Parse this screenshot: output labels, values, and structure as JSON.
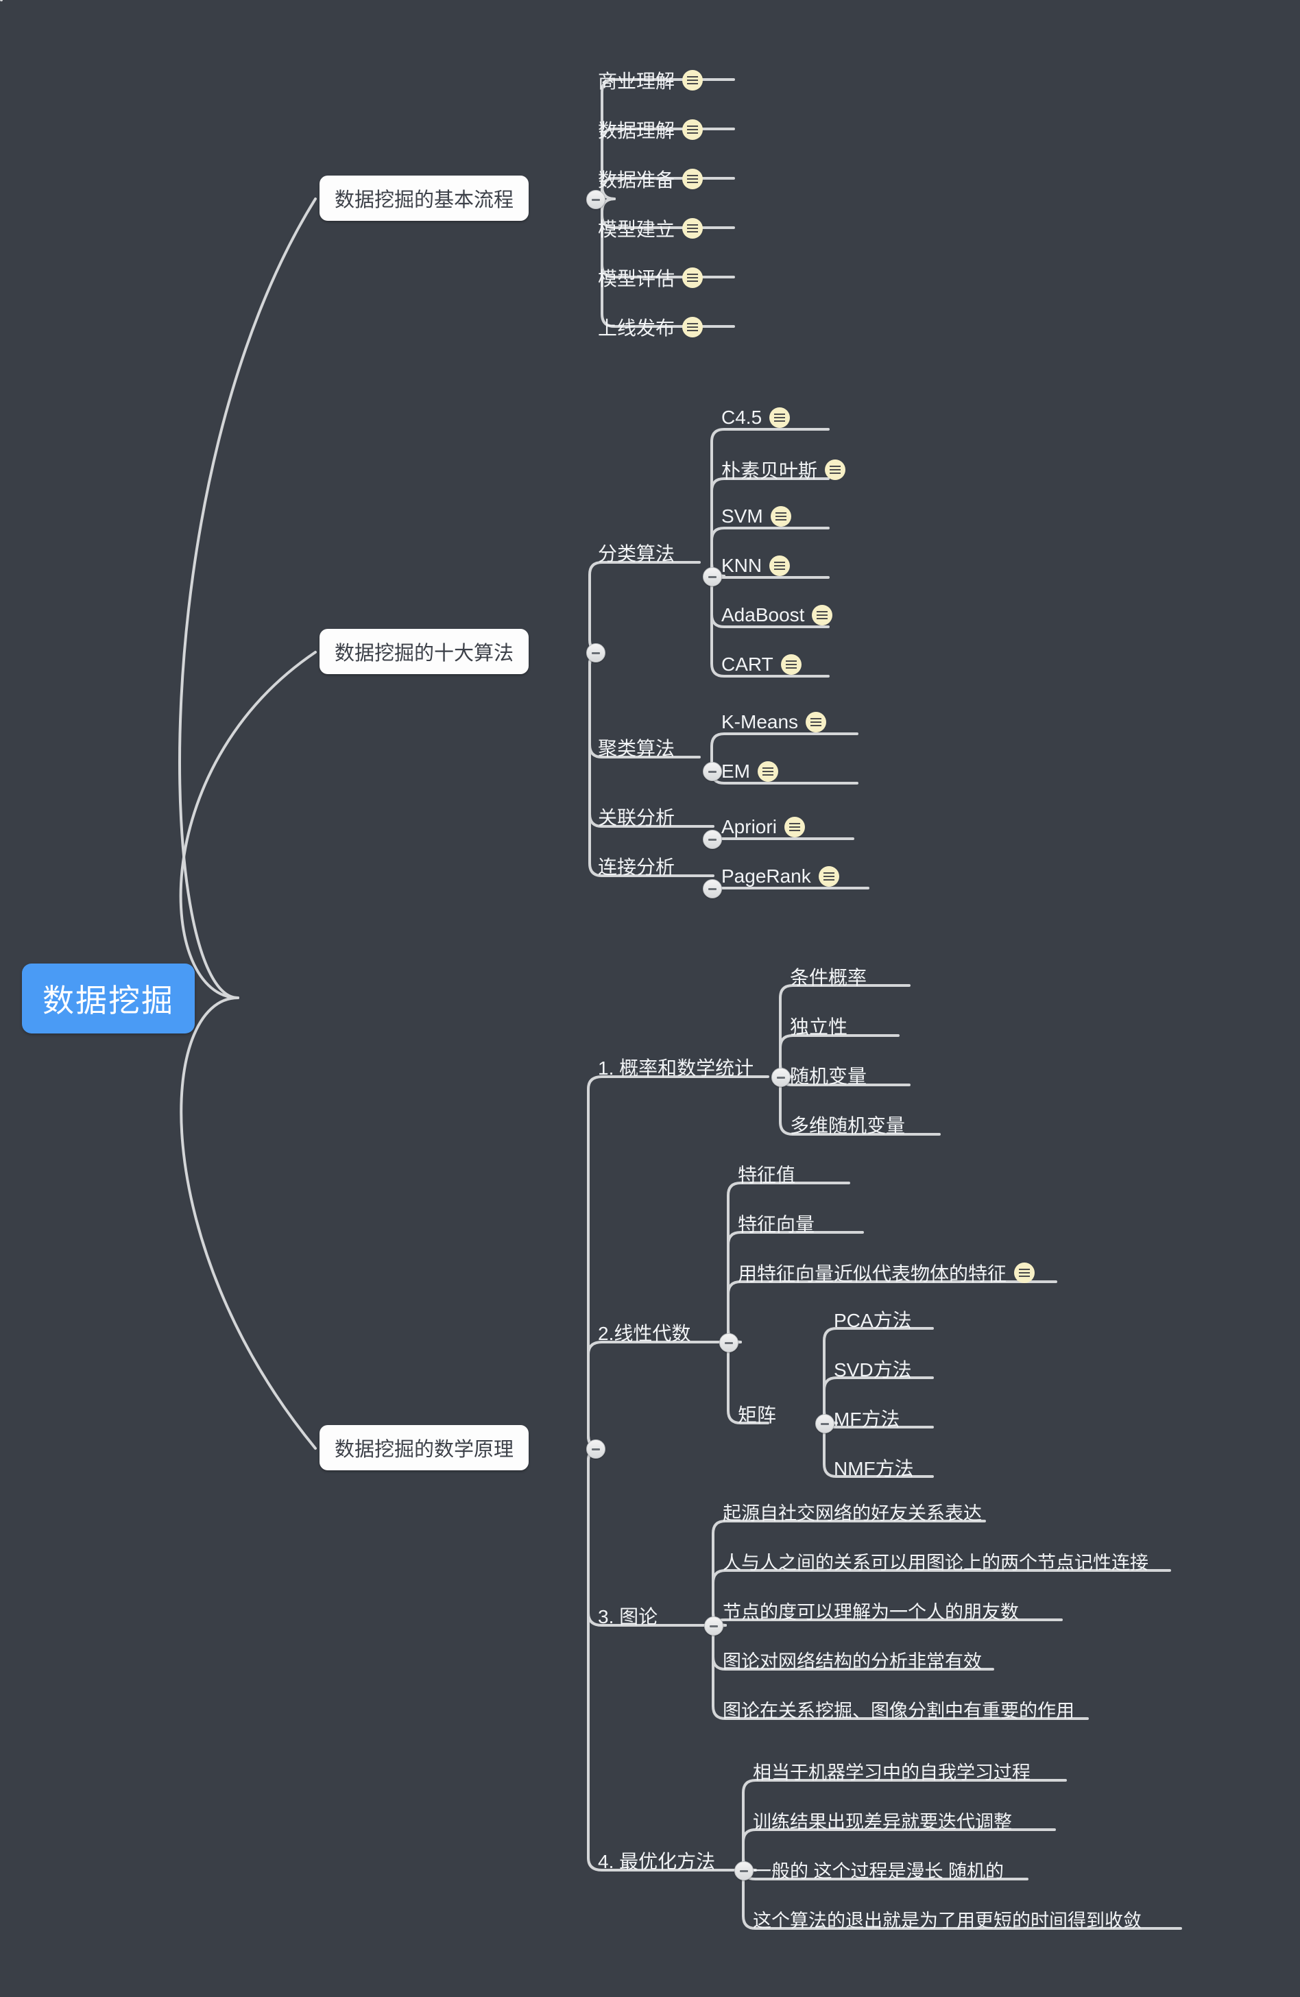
{
  "theme": {
    "background": "#3a3f47",
    "root_fill": "#4a9bf5",
    "root_text": "#ffffff",
    "branch_fill": "#fdfdfd",
    "branch_text": "#3c4048",
    "leaf_text": "#f2f4f6",
    "connector": "#d4d6d8",
    "note_icon_fill": "#f7f0c6"
  },
  "icons": {
    "note": "note-icon",
    "collapse": "collapse-minus-icon"
  },
  "root": {
    "label": "数据挖掘"
  },
  "branches": [
    {
      "id": "process",
      "label": "数据挖掘的基本流程",
      "children": [
        {
          "label": "商业理解",
          "note": true
        },
        {
          "label": "数据理解",
          "note": true
        },
        {
          "label": "数据准备",
          "note": true
        },
        {
          "label": "模型建立",
          "note": true
        },
        {
          "label": "模型评估",
          "note": true
        },
        {
          "label": "上线发布",
          "note": true
        }
      ]
    },
    {
      "id": "algorithms",
      "label": "数据挖掘的十大算法",
      "groups": [
        {
          "label": "分类算法",
          "children": [
            {
              "label": "C4.5",
              "note": true
            },
            {
              "label": "朴素贝叶斯",
              "note": true
            },
            {
              "label": "SVM",
              "note": true
            },
            {
              "label": "KNN",
              "note": true
            },
            {
              "label": "AdaBoost",
              "note": true
            },
            {
              "label": "CART",
              "note": true
            }
          ]
        },
        {
          "label": "聚类算法",
          "children": [
            {
              "label": "K-Means",
              "note": true
            },
            {
              "label": "EM",
              "note": true
            }
          ]
        },
        {
          "label": "关联分析",
          "children": [
            {
              "label": "Apriori",
              "note": true
            }
          ]
        },
        {
          "label": "连接分析",
          "children": [
            {
              "label": "PageRank",
              "note": true
            }
          ]
        }
      ]
    },
    {
      "id": "math",
      "label": "数据挖掘的数学原理",
      "groups": [
        {
          "label": "1. 概率和数学统计",
          "children": [
            {
              "label": "条件概率",
              "note": false
            },
            {
              "label": "独立性",
              "note": false
            },
            {
              "label": "随机变量",
              "note": false
            },
            {
              "label": "多维随机变量",
              "note": false
            }
          ]
        },
        {
          "label": "2.线性代数",
          "children": [
            {
              "label": "特征值",
              "note": false
            },
            {
              "label": "特征向量",
              "note": false
            },
            {
              "label": "用特征向量近似代表物体的特征",
              "note": true
            },
            {
              "label": "矩阵",
              "note": false,
              "children": [
                {
                  "label": "PCA方法",
                  "note": false
                },
                {
                  "label": "SVD方法",
                  "note": false
                },
                {
                  "label": "MF方法",
                  "note": false
                },
                {
                  "label": "NMF方法",
                  "note": false
                }
              ]
            }
          ]
        },
        {
          "label": "3. 图论",
          "children": [
            {
              "label": "起源自社交网络的好友关系表达",
              "note": false
            },
            {
              "label": "人与人之间的关系可以用图论上的两个节点记性连接",
              "note": false
            },
            {
              "label": "节点的度可以理解为一个人的朋友数",
              "note": false
            },
            {
              "label": "图论对网络结构的分析非常有效",
              "note": false
            },
            {
              "label": "图论在关系挖掘、图像分割中有重要的作用",
              "note": false
            }
          ]
        },
        {
          "label": "4. 最优化方法",
          "children": [
            {
              "label": "相当于机器学习中的自我学习过程",
              "note": false
            },
            {
              "label": "训练结果出现差异就要迭代调整",
              "note": false
            },
            {
              "label": "一般的 这个过程是漫长 随机的",
              "note": false
            },
            {
              "label": "这个算法的退出就是为了用更短的时间得到收敛",
              "note": false
            }
          ]
        }
      ]
    }
  ]
}
